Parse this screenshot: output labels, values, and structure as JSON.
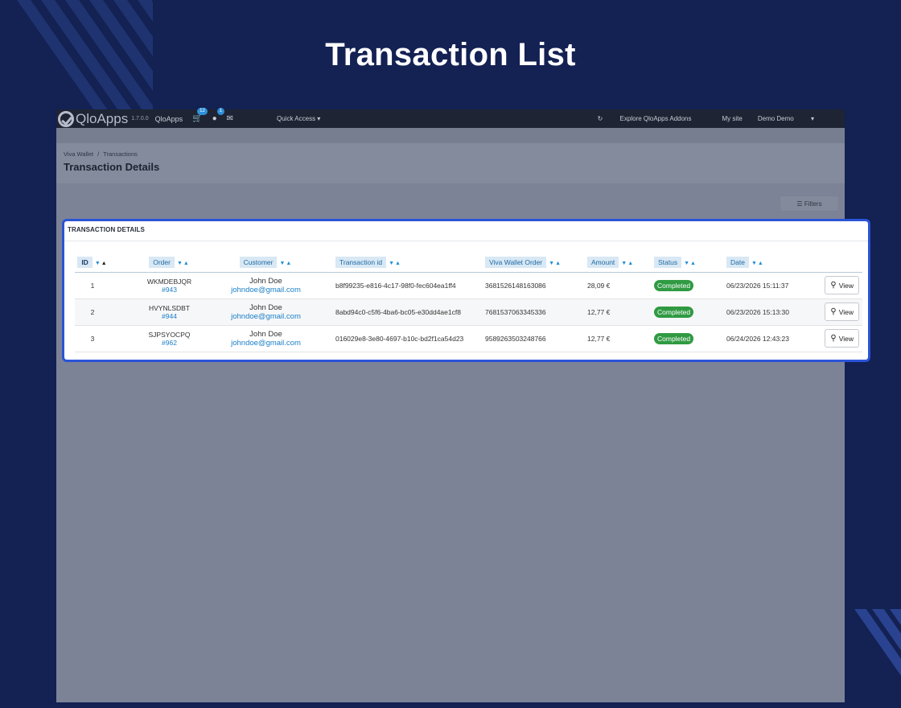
{
  "hero": {
    "title": "Transaction List"
  },
  "topbar": {
    "logo": "QloApps",
    "version": "1.7.0.0",
    "shop_name": "QloApps",
    "cart_count": "12",
    "customer_count": "1",
    "quick_access": "Quick Access",
    "explore": "Explore QloApps Addons",
    "my_site": "My site",
    "user": "Demo Demo"
  },
  "breadcrumb": {
    "parent": "Viva Wallet",
    "separator": "/",
    "current": "Transactions"
  },
  "page_title": "Transaction Details",
  "filters_label": "Filters",
  "panel": {
    "heading": "TRANSACTION DETAILS"
  },
  "table": {
    "headers": {
      "id": "ID",
      "order": "Order",
      "customer": "Customer",
      "transaction_id": "Transaction id",
      "viva_order": "Viva Wallet Order",
      "amount": "Amount",
      "status": "Status",
      "date": "Date"
    },
    "view_label": "View",
    "rows": [
      {
        "id": "1",
        "order_ref": "WKMDEBJQR",
        "order_num": "#943",
        "customer_name": "John Doe",
        "customer_email": "johndoe@gmail.com",
        "transaction_id": "b8f99235-e816-4c17-98f0-fec604ea1ff4",
        "viva_order": "3681526148163086",
        "amount": "28,09 €",
        "status": "Completed",
        "date": "06/23/2026 15:11:37"
      },
      {
        "id": "2",
        "order_ref": "HVYNLSDBT",
        "order_num": "#944",
        "customer_name": "John Doe",
        "customer_email": "johndoe@gmail.com",
        "transaction_id": "8abd94c0-c5f6-4ba6-bc05-e30dd4ae1cf8",
        "viva_order": "7681537063345336",
        "amount": "12,77 €",
        "status": "Completed",
        "date": "06/23/2026 15:13:30"
      },
      {
        "id": "3",
        "order_ref": "SJPSYOCPQ",
        "order_num": "#962",
        "customer_name": "John Doe",
        "customer_email": "johndoe@gmail.com",
        "transaction_id": "016029e8-3e80-4697-b10c-bd2f1ca54d23",
        "viva_order": "9589263503248766",
        "amount": "12,77 €",
        "status": "Completed",
        "date": "06/24/2026 12:43:23"
      }
    ]
  },
  "colors": {
    "background": "#132153",
    "highlight_border": "#2a54d6",
    "status_completed": "#2f9a42",
    "link": "#1a7fc9"
  },
  "icons": {
    "logo": "qloapps-check-logo-icon",
    "cart": "shopping-cart-icon",
    "customer": "user-icon",
    "messages": "envelope-icon",
    "explore": "puzzle-icon",
    "filters": "sliders-icon",
    "view": "magnifier-icon"
  }
}
